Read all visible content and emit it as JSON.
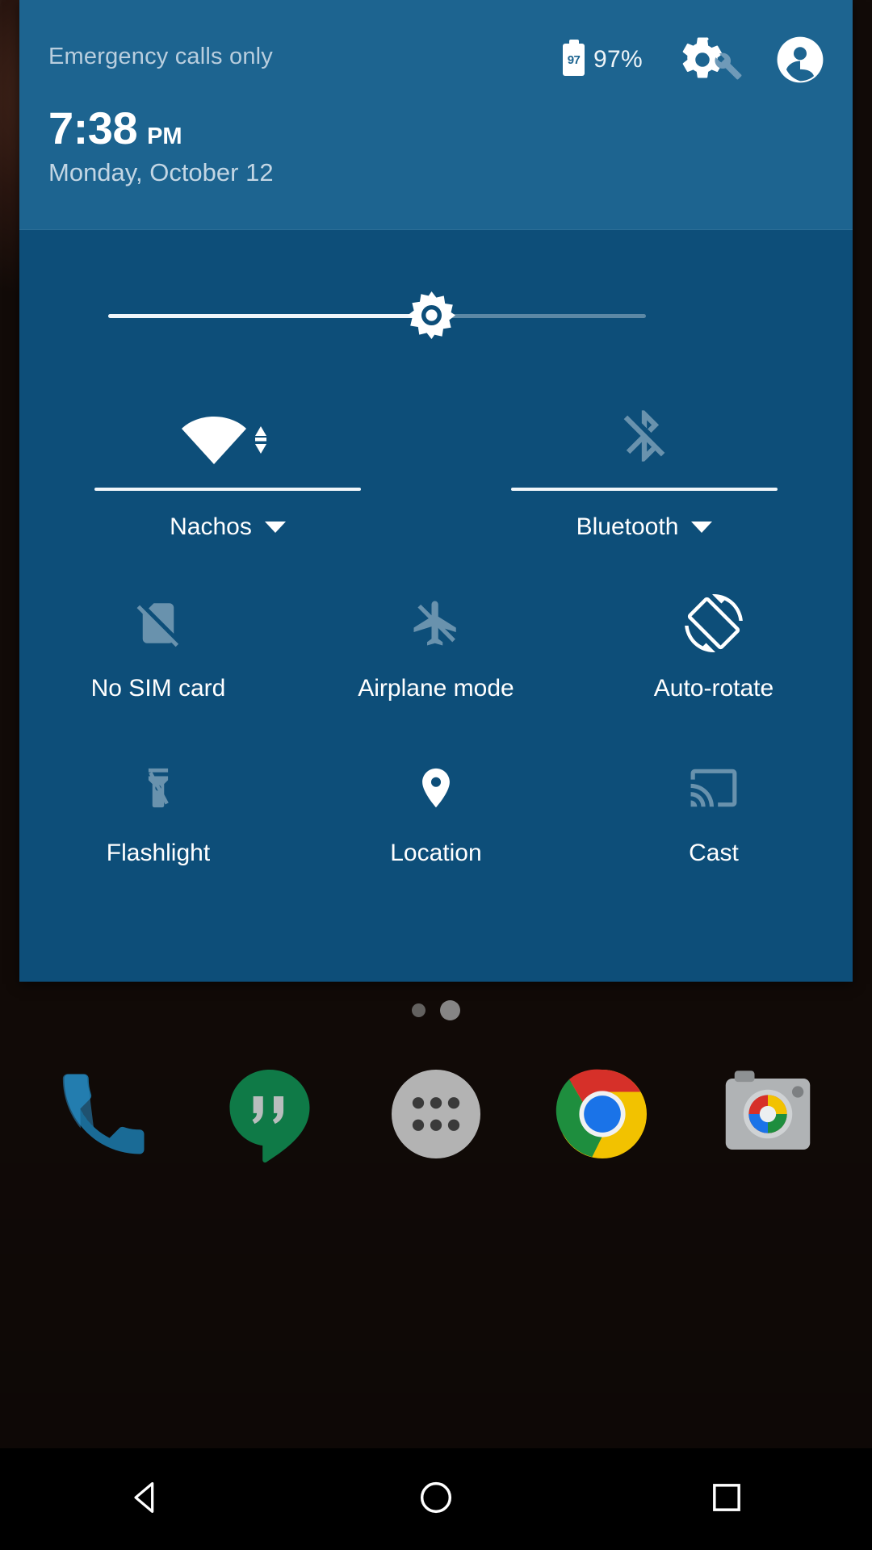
{
  "statusbar": {
    "carrier": "Emergency calls only",
    "battery_level_label": "97",
    "battery_percent": "97%",
    "settings_icon": "gear-icon",
    "tuner_icon": "wrench-icon",
    "user_icon": "account-avatar-icon"
  },
  "clock": {
    "time": "7:38",
    "ampm": "PM",
    "date": "Monday, October 12"
  },
  "brightness": {
    "label": "Brightness",
    "value_percent": 60,
    "icon": "brightness-sun-icon"
  },
  "detail_tiles": [
    {
      "name": "wifi",
      "label": "Nachos",
      "icon": "wifi-full-signal-icon",
      "state": "on",
      "has_caret": true
    },
    {
      "name": "bluetooth",
      "label": "Bluetooth",
      "icon": "bluetooth-disabled-icon",
      "state": "off",
      "has_caret": true
    }
  ],
  "tiles": [
    {
      "name": "sim",
      "label": "No SIM card",
      "icon": "sim-card-off-icon",
      "state": "off"
    },
    {
      "name": "airplane",
      "label": "Airplane mode",
      "icon": "airplane-off-icon",
      "state": "off"
    },
    {
      "name": "autorotate",
      "label": "Auto-rotate",
      "icon": "screen-rotation-icon",
      "state": "on"
    },
    {
      "name": "flashlight",
      "label": "Flashlight",
      "icon": "flashlight-off-icon",
      "state": "off"
    },
    {
      "name": "location",
      "label": "Location",
      "icon": "location-pin-icon",
      "state": "on"
    },
    {
      "name": "cast",
      "label": "Cast",
      "icon": "cast-screen-icon",
      "state": "off"
    }
  ],
  "homescreen": {
    "page_indicator": {
      "pages": 2,
      "current": 2
    },
    "dock": [
      {
        "name": "phone",
        "icon": "phone-handset-icon"
      },
      {
        "name": "hangouts",
        "icon": "hangouts-quote-bubble-icon"
      },
      {
        "name": "app-drawer",
        "icon": "app-drawer-dots-icon"
      },
      {
        "name": "chrome",
        "icon": "chrome-browser-icon"
      },
      {
        "name": "camera",
        "icon": "camera-icon"
      }
    ]
  },
  "navbar": [
    {
      "name": "back",
      "icon": "back-triangle-icon"
    },
    {
      "name": "home",
      "icon": "home-circle-icon"
    },
    {
      "name": "recents",
      "icon": "recents-square-icon"
    }
  ],
  "colors": {
    "panel_body": "#0d4e79",
    "panel_header": "#1d6490",
    "accent_text": "#ffffff",
    "muted_text": "#b9cede",
    "navbar": "#000000"
  }
}
